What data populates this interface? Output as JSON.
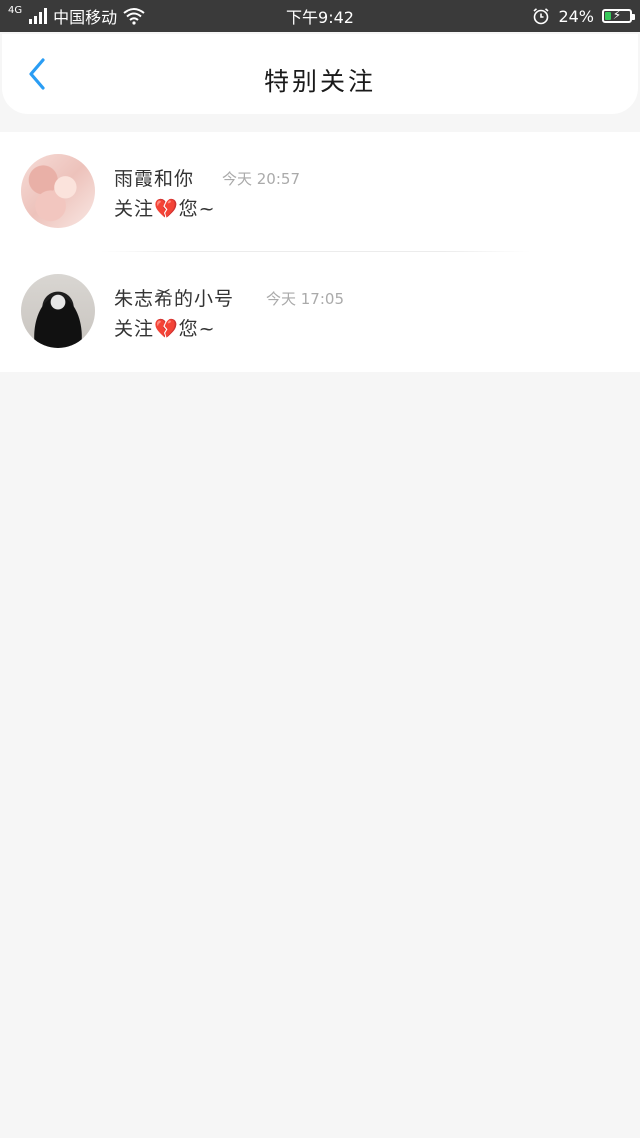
{
  "status_bar": {
    "network": "4G",
    "carrier": "中国移动",
    "time": "下午9:42",
    "battery": "24%",
    "battery_level": 0.24
  },
  "header": {
    "title": "特别关注"
  },
  "items": [
    {
      "name": "雨霞和你",
      "time": "今天 20:57",
      "action": "关注💔您~"
    },
    {
      "name": "朱志希的小号",
      "time": "今天 17:05",
      "action": "关注💔您~"
    }
  ],
  "colors": {
    "accent": "#2a9df4",
    "status_bar_bg": "#3a3a3a",
    "page_bg": "#f6f6f6",
    "battery_fill": "#37c85a"
  }
}
